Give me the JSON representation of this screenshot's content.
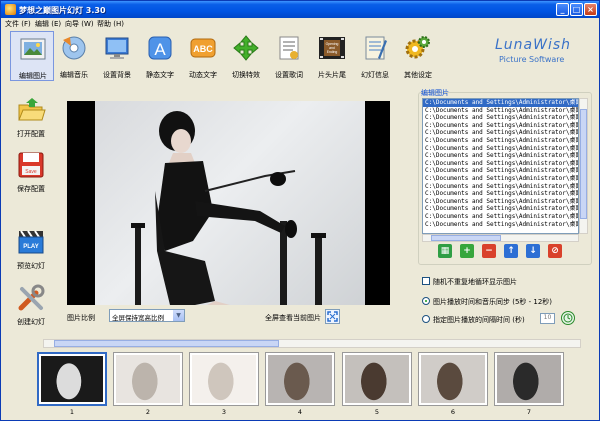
{
  "window": {
    "title": "梦想之巅图片幻灯 3.30",
    "minimize_label": "_",
    "maximize_label": "□",
    "close_label": "×"
  },
  "menu": [
    "文件 (F)",
    "编辑 (E)",
    "向导 (W)",
    "帮助 (H)"
  ],
  "toolbar": [
    {
      "label": "编辑图片",
      "icon": "photo-edit-icon"
    },
    {
      "label": "编辑音乐",
      "icon": "music-disc-icon"
    },
    {
      "label": "设置背景",
      "icon": "monitor-icon"
    },
    {
      "label": "静态文字",
      "icon": "letter-a-icon"
    },
    {
      "label": "动态文字",
      "icon": "abc-text-icon"
    },
    {
      "label": "切换特效",
      "icon": "transition-arrows-icon"
    },
    {
      "label": "设置歌词",
      "icon": "lyrics-icon"
    },
    {
      "label": "片头片尾",
      "icon": "opening-ending-icon",
      "icon_text": "Opening and Ending"
    },
    {
      "label": "幻灯信息",
      "icon": "notebook-icon"
    },
    {
      "label": "其他设定",
      "icon": "gears-icon"
    }
  ],
  "brand": {
    "name": "LunaWish",
    "tagline": "Picture Software"
  },
  "sidebar": [
    {
      "label": "打开配置",
      "icon": "open-folder-icon"
    },
    {
      "label": "保存配置",
      "icon": "save-disk-icon",
      "icon_text": "Save"
    },
    {
      "label": "预览幻灯",
      "icon": "play-clapper-icon",
      "icon_text": "PLAY"
    },
    {
      "label": "创建幻灯",
      "icon": "tools-icon"
    }
  ],
  "preview": {
    "ratio_label": "图片比例",
    "ratio_value": "全屏保持宽高比例",
    "fullscreen_label": "全屏查看当前图片"
  },
  "image_list": {
    "title": "编辑图片",
    "items": [
      "C:\\Documents and Settings\\Administrator\\桌面\\",
      "C:\\Documents and Settings\\Administrator\\桌面\\",
      "C:\\Documents and Settings\\Administrator\\桌面\\",
      "C:\\Documents and Settings\\Administrator\\桌面\\",
      "C:\\Documents and Settings\\Administrator\\桌面\\",
      "C:\\Documents and Settings\\Administrator\\桌面\\",
      "C:\\Documents and Settings\\Administrator\\桌面\\",
      "C:\\Documents and Settings\\Administrator\\桌面\\",
      "C:\\Documents and Settings\\Administrator\\桌面\\",
      "C:\\Documents and Settings\\Administrator\\桌面\\",
      "C:\\Documents and Settings\\Administrator\\桌面\\",
      "C:\\Documents and Settings\\Administrator\\桌面\\",
      "C:\\Documents and Settings\\Administrator\\桌面\\",
      "C:\\Documents and Settings\\Administrator\\桌面\\",
      "C:\\Documents and Settings\\Administrator\\桌面\\",
      "C:\\Documents and Settings\\Administrator\\桌面\\",
      "C:\\Documents and Settings\\Administrator\\桌面\\"
    ],
    "selected_index": 0
  },
  "list_actions": [
    {
      "icon": "select-all-icon",
      "glyph": "▦",
      "color": "#2f9e44"
    },
    {
      "icon": "add-icon",
      "glyph": "+",
      "color": "#37a63c"
    },
    {
      "icon": "remove-icon",
      "glyph": "−",
      "color": "#d9412b"
    },
    {
      "icon": "move-up-icon",
      "glyph": "↑",
      "color": "#2d6fd4"
    },
    {
      "icon": "move-down-icon",
      "glyph": "↓",
      "color": "#2d6fd4"
    },
    {
      "icon": "delete-icon",
      "glyph": "⊘",
      "color": "#d9412b"
    }
  ],
  "options": {
    "random_no_repeat": "随机不重复地循环显示图片",
    "sync_music": "图片播放时间和音乐同步 (5秒 - 12秒)",
    "custom_interval": "指定图片播放的间隔时间 (秒)",
    "interval_value": "10",
    "sync_music_selected": true
  },
  "thumbnails": [
    {
      "num": "1",
      "selected": true
    },
    {
      "num": "2",
      "selected": false
    },
    {
      "num": "3",
      "selected": false
    },
    {
      "num": "4",
      "selected": false
    },
    {
      "num": "5",
      "selected": false
    },
    {
      "num": "6",
      "selected": false
    },
    {
      "num": "7",
      "selected": false
    }
  ]
}
